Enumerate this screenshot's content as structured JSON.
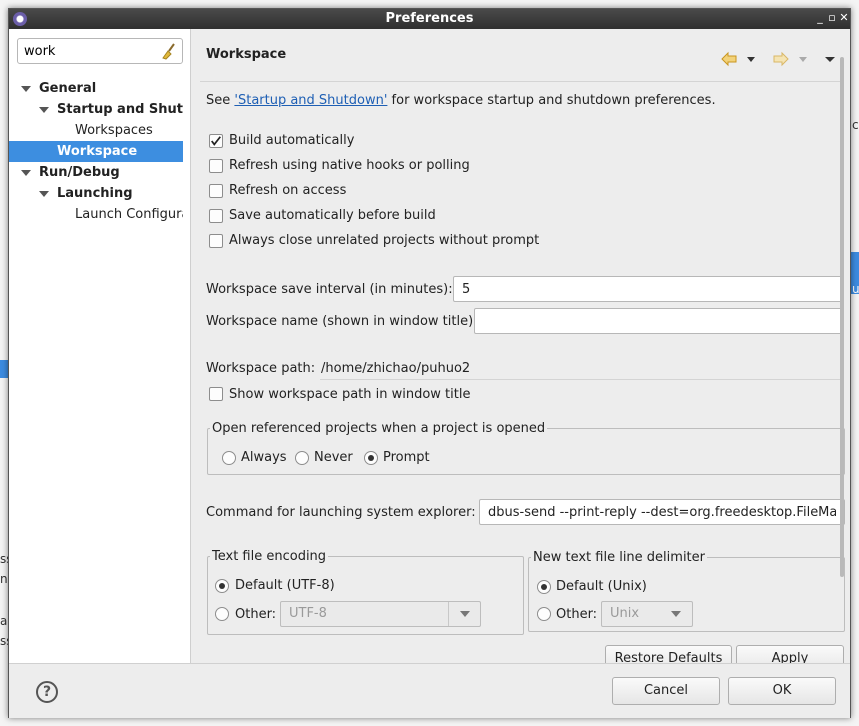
{
  "window": {
    "title": "Preferences"
  },
  "filter": {
    "value": "work"
  },
  "tree": [
    {
      "label": "General",
      "level": 0,
      "expanded": true
    },
    {
      "label": "Startup and Shutdown",
      "level": 1,
      "expanded": true
    },
    {
      "label": "Workspaces",
      "level": 2
    },
    {
      "label": "Workspace",
      "level": 1,
      "selected": true
    },
    {
      "label": "Run/Debug",
      "level": 0,
      "expanded": true
    },
    {
      "label": "Launching",
      "level": 1,
      "expanded": true
    },
    {
      "label": "Launch Configurations",
      "level": 2
    }
  ],
  "page": {
    "title": "Workspace",
    "see_prefix": "See ",
    "see_link": "'Startup and Shutdown'",
    "see_suffix": " for workspace startup and shutdown preferences.",
    "checkboxes": [
      {
        "label": "Build automatically",
        "checked": true
      },
      {
        "label": "Refresh using native hooks or polling",
        "checked": false
      },
      {
        "label": "Refresh on access",
        "checked": false
      },
      {
        "label": "Save automatically before build",
        "checked": false
      },
      {
        "label": "Always close unrelated projects without prompt",
        "checked": false
      }
    ],
    "save_interval_label": "Workspace save interval (in minutes):",
    "save_interval_value": "5",
    "workspace_name_label": "Workspace name (shown in window title):",
    "workspace_name_value": "",
    "workspace_path_label": "Workspace path:",
    "workspace_path_value": "/home/zhichao/puhuo2",
    "show_path_label": "Show workspace path in window title",
    "open_ref_group": "Open referenced projects when a project is opened",
    "open_ref_options": [
      {
        "label": "Always",
        "selected": false
      },
      {
        "label": "Never",
        "selected": false
      },
      {
        "label": "Prompt",
        "selected": true
      }
    ],
    "explorer_label": "Command for launching system explorer:",
    "explorer_value": "dbus-send --print-reply --dest=org.freedesktop.FileMar",
    "encoding_group": "Text file encoding",
    "encoding_default": "Default (UTF-8)",
    "encoding_other": "Other:",
    "encoding_other_value": "UTF-8",
    "delimiter_group": "New text file line delimiter",
    "delimiter_default": "Default (Unix)",
    "delimiter_other": "Other:",
    "delimiter_other_value": "Unix",
    "restore_defaults": "Restore Defaults",
    "apply": "Apply"
  },
  "buttons": {
    "cancel": "Cancel",
    "ok": "OK"
  },
  "background_fragments": [
    "c",
    "u",
    "ss",
    "nir",
    "a",
    "ss"
  ]
}
